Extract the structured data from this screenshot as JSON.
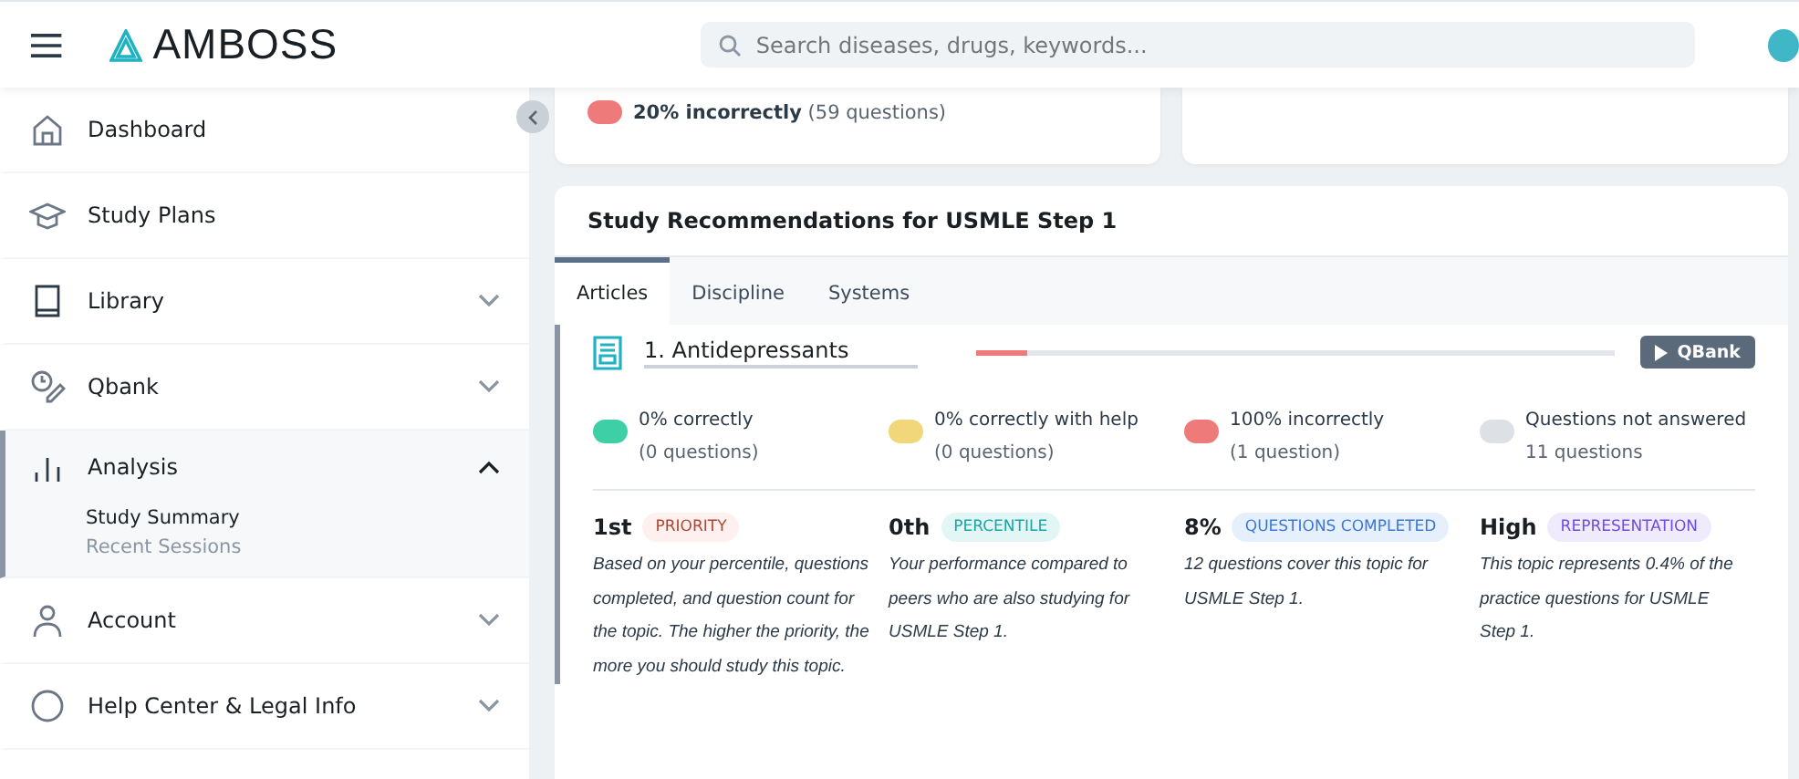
{
  "header": {
    "logo": "AMBOSS",
    "search": {
      "placeholder": "Search diseases, drugs, keywords..."
    }
  },
  "sidebar": {
    "items": [
      {
        "label": "Dashboard",
        "selected": false
      },
      {
        "label": "Study Plans",
        "selected": false
      },
      {
        "label": "Library",
        "expanded": false,
        "selected": false
      },
      {
        "label": "Qbank",
        "expanded": false,
        "selected": false
      },
      {
        "label": "Analysis",
        "expanded": true,
        "selected": true,
        "children": [
          {
            "label": "Study Summary",
            "selected": true
          },
          {
            "label": "Recent Sessions",
            "selected": false
          }
        ]
      },
      {
        "label": "Account",
        "expanded": false,
        "selected": false
      },
      {
        "label": "Help Center & Legal Info",
        "expanded": false,
        "selected": false
      }
    ]
  },
  "top_card": {
    "strong": "20% incorrectly",
    "rest": "(59 questions)",
    "color": "#ef7a7a"
  },
  "recommendations": {
    "title": "Study Recommendations for USMLE Step 1",
    "tabs": [
      {
        "label": "Articles",
        "selected": true
      },
      {
        "label": "Discipline",
        "selected": false
      },
      {
        "label": "Systems",
        "selected": false
      }
    ],
    "article": {
      "title": "1. Antidepressants",
      "level": 0.08,
      "button": "QBank",
      "legend": [
        {
          "label": "0% correctly",
          "detail": "(0 questions)",
          "color": "#3ecfa6"
        },
        {
          "label": "0% correctly with help",
          "detail": "(0 questions)",
          "color": "#f2d77a"
        },
        {
          "label": "100% incorrectly",
          "detail": "(1 question)",
          "color": "#ef7a7a"
        },
        {
          "label": "Questions not answered",
          "detail": "11 questions",
          "color": "#dde1e6"
        }
      ],
      "stats": [
        {
          "value": "1st",
          "tag": "PRIORITY",
          "kind": "priority",
          "text": "Based on your percentile, questions completed, and question count for the topic. The higher the priority, the more you should study this topic."
        },
        {
          "value": "0th",
          "tag": "PERCENTILE",
          "kind": "percentile",
          "text": "Your performance compared to peers who are also studying for USMLE Step 1."
        },
        {
          "value": "8%",
          "tag": "QUESTIONS COMPLETED",
          "kind": "completed",
          "text": "12 questions cover this topic for USMLE Step 1."
        },
        {
          "value": "High",
          "tag": "REPRESENTATION",
          "kind": "representation",
          "text": "This topic represents 0.4% of the practice questions for USMLE Step 1."
        }
      ]
    }
  }
}
